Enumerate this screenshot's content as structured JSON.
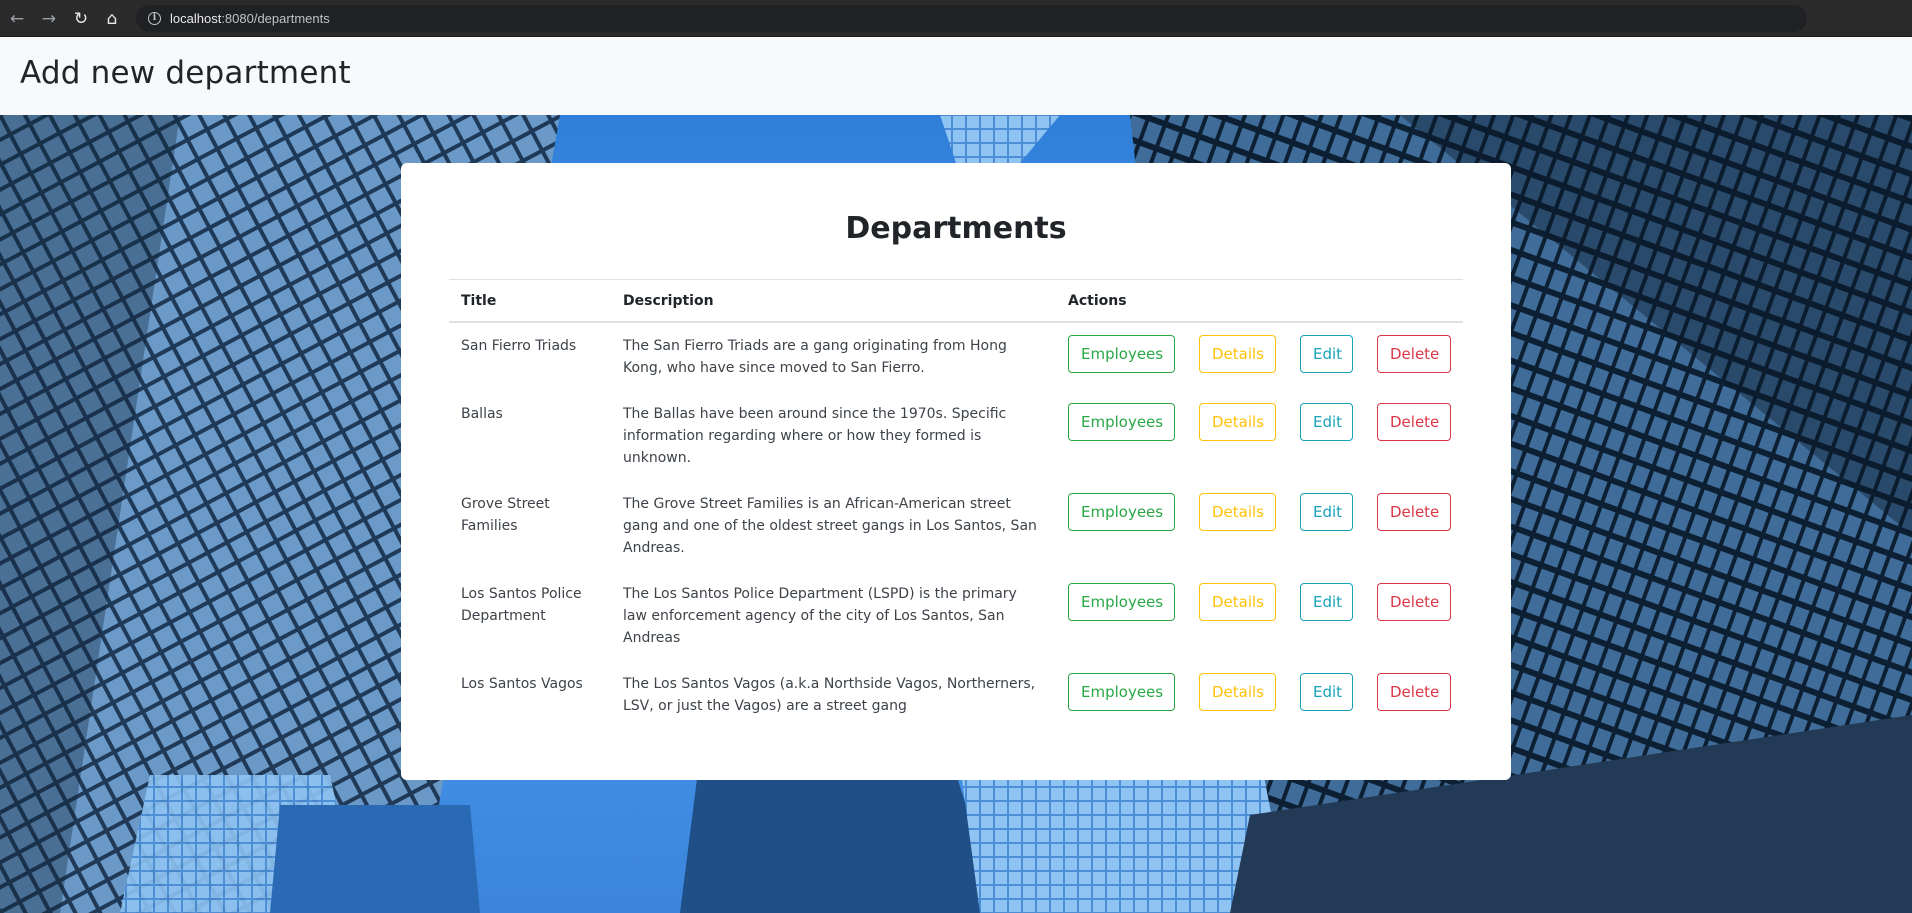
{
  "browser": {
    "url_host": "localhost",
    "url_path": ":8080/departments"
  },
  "header": {
    "add_link": "Add new department"
  },
  "card": {
    "title": "Departments"
  },
  "table": {
    "columns": [
      "Title",
      "Description",
      "Actions"
    ],
    "button_labels": {
      "employees": "Employees",
      "details": "Details",
      "edit": "Edit",
      "delete": "Delete"
    },
    "rows": [
      {
        "title": "San Fierro Triads",
        "description": "The San Fierro Triads are a gang originating from Hong Kong, who have since moved to San Fierro."
      },
      {
        "title": "Ballas",
        "description": "The Ballas have been around since the 1970s. Specific information regarding where or how they formed is unknown."
      },
      {
        "title": "Grove Street Families",
        "description": "The Grove Street Families is an African-American street gang and one of the oldest street gangs in Los Santos, San Andreas."
      },
      {
        "title": "Los Santos Police Department",
        "description": "The Los Santos Police Department (LSPD) is the primary law enforcement agency of the city of Los Santos, San Andreas"
      },
      {
        "title": "Los Santos Vagos",
        "description": "The Los Santos Vagos (a.k.a Northside Vagos, Northerners, LSV, or just the Vagos) are a street gang"
      }
    ]
  },
  "colors": {
    "employees": "#28a745",
    "details": "#ffc107",
    "edit": "#17a2b8",
    "delete": "#dc3545"
  }
}
